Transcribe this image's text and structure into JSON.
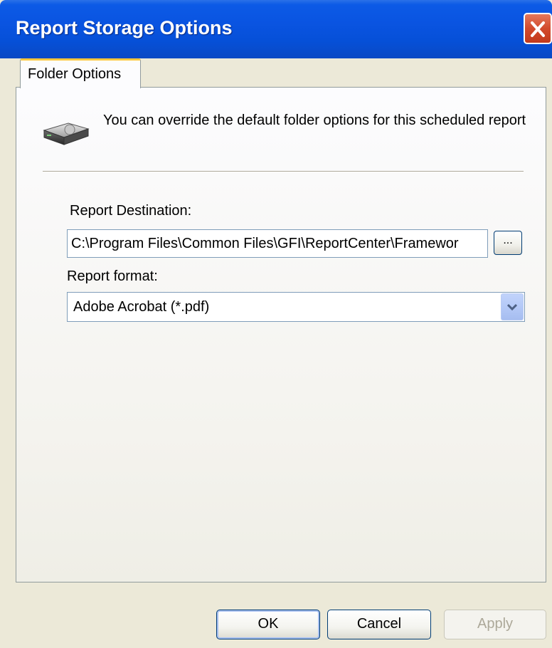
{
  "window": {
    "title": "Report Storage Options",
    "title_bar_color": "#0a54e1",
    "close_icon": "close-icon"
  },
  "tabs": [
    {
      "label": "Folder Options",
      "active": true
    }
  ],
  "panel": {
    "icon": "hard-drive-icon",
    "info_text": "You can override the default folder options for this scheduled report",
    "destination": {
      "label": "Report Destination:",
      "value": "C:\\Program Files\\Common Files\\GFI\\ReportCenter\\Framewor",
      "browse_label": "..."
    },
    "format": {
      "label": "Report format:",
      "selected": "Adobe Acrobat (*.pdf)",
      "dropdown_icon": "chevron-down-icon"
    }
  },
  "buttons": {
    "ok": "OK",
    "cancel": "Cancel",
    "apply": "Apply",
    "apply_disabled": true
  }
}
